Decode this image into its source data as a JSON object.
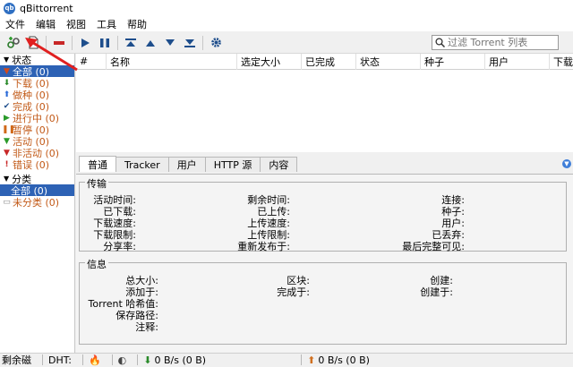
{
  "window": {
    "title": "qBittorrent",
    "app_icon_text": "qb"
  },
  "menu": [
    "文件",
    "编辑",
    "视图",
    "工具",
    "帮助"
  ],
  "toolbar": {
    "icons": [
      "add-link-icon",
      "add-file-icon",
      "remove-icon",
      "resume-icon",
      "pause-icon",
      "move-top-icon",
      "move-up-icon",
      "move-down-icon",
      "move-bottom-icon",
      "options-icon"
    ],
    "filter_placeholder": "过滤 Torrent 列表"
  },
  "sidebar": {
    "status_header": "状态",
    "status_items": [
      {
        "label": "全部 (0)",
        "icon": "all-icon",
        "selected": true
      },
      {
        "label": "下载 (0)",
        "icon": "download-icon"
      },
      {
        "label": "做种 (0)",
        "icon": "seed-icon"
      },
      {
        "label": "完成 (0)",
        "icon": "complete-icon"
      },
      {
        "label": "进行中 (0)",
        "icon": "active-transfer-icon"
      },
      {
        "label": "暂停 (0)",
        "icon": "paused-icon"
      },
      {
        "label": "活动 (0)",
        "icon": "active-icon"
      },
      {
        "label": "非活动 (0)",
        "icon": "inactive-icon"
      },
      {
        "label": "错误 (0)",
        "icon": "error-icon"
      }
    ],
    "category_header": "分类",
    "category_items": [
      {
        "label": "全部 (0)",
        "selected": true
      },
      {
        "label": "未分类 (0)",
        "icon": "uncategorized-icon"
      }
    ]
  },
  "table": {
    "columns": [
      "#",
      "名称",
      "选定大小",
      "已完成",
      "状态",
      "种子",
      "用户",
      "下载"
    ]
  },
  "tabs": [
    "普通",
    "Tracker",
    "用户",
    "HTTP 源",
    "内容"
  ],
  "transfer": {
    "title": "传输",
    "col1": [
      "活动时间:",
      "已下载:",
      "下载速度:",
      "下载限制:",
      "分享率:"
    ],
    "col2": [
      "剩余时间:",
      "已上传:",
      "上传速度:",
      "上传限制:",
      "重新发布于:"
    ],
    "col3": [
      "连接:",
      "种子:",
      "用户:",
      "已丢弃:",
      "最后完整可见:"
    ]
  },
  "info": {
    "title": "信息",
    "col1": [
      "总大小:",
      "添加于:",
      "Torrent 哈希值:",
      "保存路径:",
      "注释:"
    ],
    "col2": [
      "区块:",
      "完成于:"
    ],
    "col3": [
      "创建:",
      "创建于:"
    ]
  },
  "status": {
    "disk": "剩余磁",
    "dht": "DHT:",
    "download": "0 B/s (0 B)",
    "upload": "0 B/s (0 B)"
  },
  "colors": {
    "selection": "#2d62b5",
    "sidebar_text": "#c25a18",
    "annotation_arrow": "#e02020"
  }
}
